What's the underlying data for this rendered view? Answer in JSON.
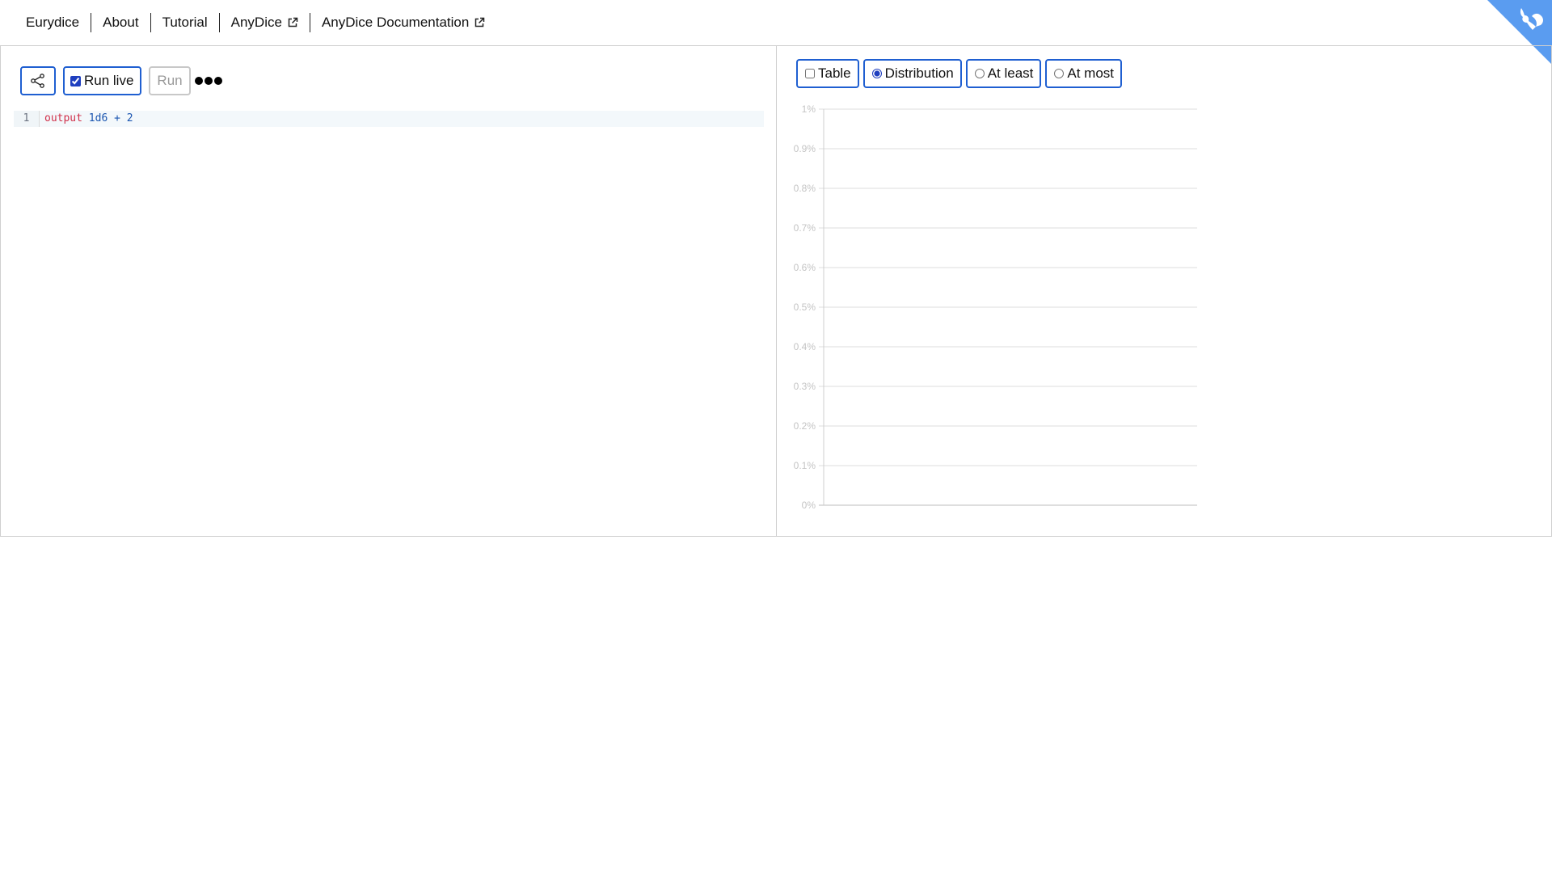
{
  "nav": {
    "items": [
      {
        "label": "Eurydice",
        "external": false
      },
      {
        "label": "About",
        "external": false
      },
      {
        "label": "Tutorial",
        "external": false
      },
      {
        "label": "AnyDice",
        "external": true
      },
      {
        "label": "AnyDice Documentation",
        "external": true
      }
    ]
  },
  "github_corner": {
    "icon": "github-octocat-icon",
    "color": "#5a9cf0"
  },
  "editor_panel": {
    "share_icon": "share-icon",
    "run_live_label": "Run live",
    "run_live_checked": true,
    "run_label": "Run",
    "run_disabled": true,
    "busy_indicator": "loading-dots-icon",
    "code": {
      "line_number": "1",
      "tokens": [
        {
          "text": "output",
          "kind": "kw"
        },
        {
          "text": " ",
          "kind": "plain"
        },
        {
          "text": "1d6",
          "kind": "num"
        },
        {
          "text": " + ",
          "kind": "op"
        },
        {
          "text": "2",
          "kind": "num"
        }
      ]
    }
  },
  "output_panel": {
    "options": {
      "table_label": "Table",
      "table_checked": false,
      "distribution_label": "Distribution",
      "at_least_label": "At least",
      "at_most_label": "At most",
      "selected_mode": "distribution"
    }
  },
  "chart_data": {
    "type": "bar",
    "categories": [],
    "values": [],
    "title": "",
    "xlabel": "",
    "ylabel": "",
    "ylim": [
      0,
      0.01
    ],
    "y_ticks": [
      "0%",
      "0.1%",
      "0.2%",
      "0.3%",
      "0.4%",
      "0.5%",
      "0.6%",
      "0.7%",
      "0.8%",
      "0.9%",
      "1%"
    ],
    "grid": true,
    "legend": "none"
  },
  "colors": {
    "accent": "#1f5fd1",
    "keyword": "#d0304a",
    "number": "#1a55b0",
    "gridline": "#dddddd",
    "tick_label": "#c4c4c4"
  }
}
